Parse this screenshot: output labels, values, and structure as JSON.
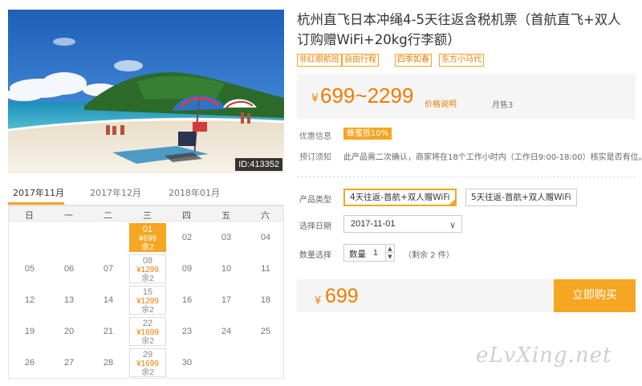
{
  "photo": {
    "id_label": "ID:413352"
  },
  "calendar": {
    "tabs": [
      "2017年11月",
      "2017年12月",
      "2018年01月"
    ],
    "weekdays": [
      "日",
      "一",
      "二",
      "三",
      "四",
      "五",
      "六"
    ],
    "days": [
      {
        "d": "01",
        "price": "¥699",
        "remain": "余2",
        "selected": true
      },
      {
        "d": "02"
      },
      {
        "d": "03"
      },
      {
        "d": "04"
      },
      {
        "d": "05"
      },
      {
        "d": "06"
      },
      {
        "d": "07"
      },
      {
        "d": "08",
        "price": "¥1299",
        "remain": "余2"
      },
      {
        "d": "09"
      },
      {
        "d": "10"
      },
      {
        "d": "11"
      },
      {
        "d": "12"
      },
      {
        "d": "13"
      },
      {
        "d": "14"
      },
      {
        "d": "15",
        "price": "¥1299",
        "remain": "余2"
      },
      {
        "d": "16"
      },
      {
        "d": "17"
      },
      {
        "d": "18"
      },
      {
        "d": "19"
      },
      {
        "d": "20"
      },
      {
        "d": "21"
      },
      {
        "d": "22",
        "price": "¥1699",
        "remain": "余2"
      },
      {
        "d": "23"
      },
      {
        "d": "24"
      },
      {
        "d": "25"
      },
      {
        "d": "26"
      },
      {
        "d": "27"
      },
      {
        "d": "28"
      },
      {
        "d": "29",
        "price": "¥1699",
        "remain": "余2"
      },
      {
        "d": "30"
      }
    ]
  },
  "product": {
    "title": "杭州直飞日本冲绳4-5天往返含税机票（首航直飞+双人订购赠WiFi+20kg行李额）",
    "tags": [
      "非红眼航班",
      "自由行程",
      "四季如春",
      "东方小马代"
    ],
    "price_yen": "¥",
    "price_range": "699~2299",
    "price_note": "价格说明",
    "monthly_sales": "月售3"
  },
  "info": {
    "promo_label": "优惠信息",
    "promo_badge": "蜂蜜抵10%",
    "booking_label": "预订须知",
    "booking_text": "此产品需二次确认，商家将在18个工作小时内（工作日9:00-18:00）核实是否有位。"
  },
  "form": {
    "type_label": "产品类型",
    "options": [
      "4天往返-首航+双人赠WiFi",
      "5天往返-首航+双人赠WiFi"
    ],
    "date_label": "选择日期",
    "date_value": "2017-11-01",
    "qty_label": "数量选择",
    "qty_prefix": "数量",
    "qty_value": "1",
    "qty_up": "▲",
    "qty_down": "▼",
    "remain": "（剩余 2 件）"
  },
  "buy": {
    "price_yen": "¥",
    "price": "699",
    "button": "立即购买"
  },
  "watermark": "eLvXing.net",
  "colors": {
    "accent": "#f5a623",
    "price": "#f07c00"
  }
}
